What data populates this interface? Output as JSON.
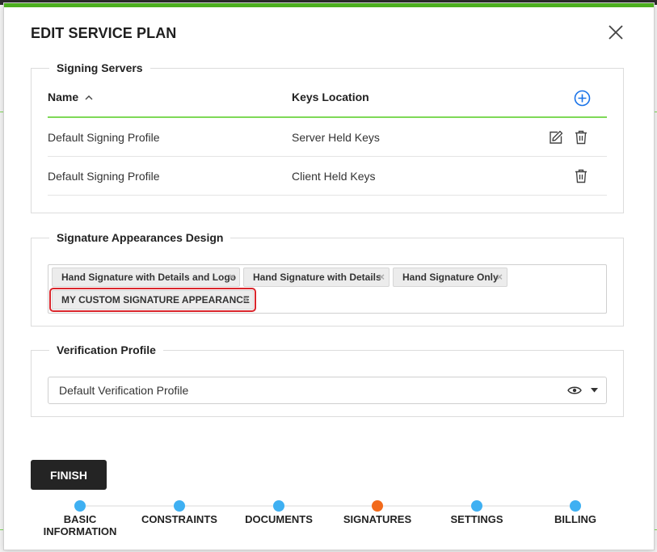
{
  "modal": {
    "title": "EDIT SERVICE PLAN"
  },
  "signing_servers": {
    "legend": "Signing Servers",
    "columns": {
      "name": "Name",
      "keys_location": "Keys Location"
    },
    "rows": [
      {
        "name": "Default Signing Profile",
        "keys_location": "Server Held Keys",
        "editable": true
      },
      {
        "name": "Default Signing Profile",
        "keys_location": "Client Held Keys",
        "editable": false
      }
    ]
  },
  "signature_appearances": {
    "legend": "Signature Appearances Design",
    "tags": [
      "Hand Signature with Details and Logo",
      "Hand Signature with Details",
      "Hand Signature Only",
      "MY CUSTOM SIGNATURE APPEARANCE"
    ]
  },
  "verification_profile": {
    "legend": "Verification Profile",
    "selected": "Default Verification Profile"
  },
  "finish_label": "FINISH",
  "steps": [
    {
      "label": "BASIC\nINFORMATION",
      "color": "#3fb0f2"
    },
    {
      "label": "CONSTRAINTS",
      "color": "#3fb0f2"
    },
    {
      "label": "DOCUMENTS",
      "color": "#3fb0f2"
    },
    {
      "label": "SIGNATURES",
      "color": "#f26a1b"
    },
    {
      "label": "SETTINGS",
      "color": "#3fb0f2"
    },
    {
      "label": "BILLING",
      "color": "#3fb0f2"
    }
  ],
  "colors": {
    "accent_green": "#4caf1f",
    "rule_green": "#7ed957",
    "step_blue": "#3fb0f2",
    "step_active": "#f26a1b",
    "highlight_red": "#d9262c",
    "add_blue": "#1a73e8"
  }
}
